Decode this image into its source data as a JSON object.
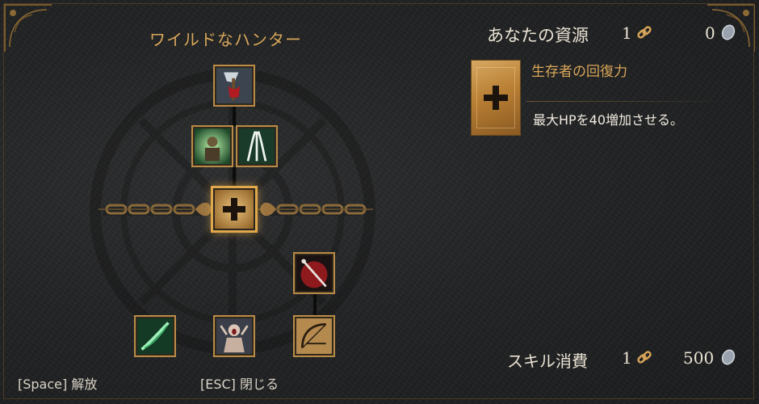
{
  "tree": {
    "title": "ワイルドなハンター",
    "nodes": [
      {
        "name": "skill-axe-blood",
        "icon": "bloody-axe-icon"
      },
      {
        "name": "skill-green-warrior",
        "icon": "green-aura-warrior-icon"
      },
      {
        "name": "skill-white-claws",
        "icon": "white-claws-icon"
      },
      {
        "name": "skill-survivor-recovery",
        "icon": "plus-cross-icon",
        "selected": true
      },
      {
        "name": "skill-red-arrow",
        "icon": "red-arrow-icon"
      },
      {
        "name": "skill-green-bow",
        "icon": "green-bow-icon"
      },
      {
        "name": "skill-screaming-beast",
        "icon": "screaming-figure-icon"
      },
      {
        "name": "skill-crossbow",
        "icon": "bow-outline-icon"
      }
    ]
  },
  "resources": {
    "label": "あなたの資源",
    "skill_points": "1",
    "silver": "0"
  },
  "detail": {
    "title": "生存者の回復力",
    "description": "最大HPを40増加させる。"
  },
  "cost": {
    "label": "スキル消費",
    "skill_points": "1",
    "silver": "500"
  },
  "hints": {
    "unlock": "[Space] 解放",
    "close": "[ESC] 閉じる"
  },
  "colors": {
    "accent_gold": "#d8a65a",
    "frame_gold": "#b98b48",
    "background": "#242526",
    "text_light": "#e9e2d4"
  }
}
